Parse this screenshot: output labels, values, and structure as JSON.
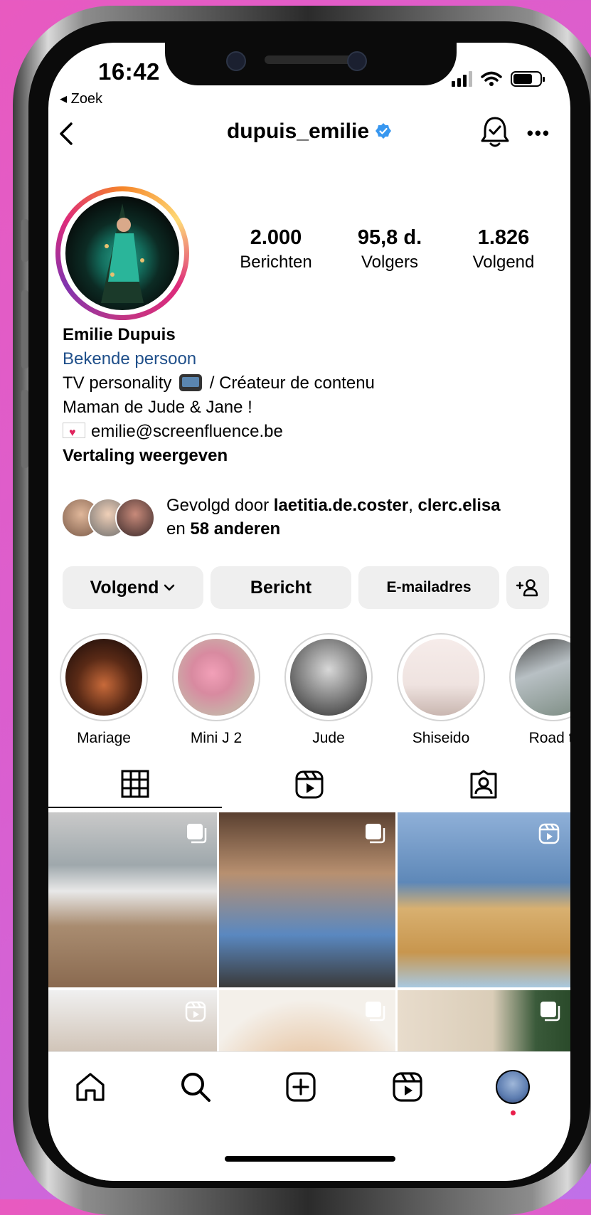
{
  "status_bar": {
    "time": "16:42",
    "back_app": "◂ Zoek"
  },
  "header": {
    "username": "dupuis_emilie"
  },
  "profile": {
    "stats": [
      {
        "value": "2.000",
        "label": "Berichten"
      },
      {
        "value": "95,8 d.",
        "label": "Volgers"
      },
      {
        "value": "1.826",
        "label": "Volgend"
      }
    ],
    "name": "Emilie Dupuis",
    "category": "Bekende persoon",
    "bio_line1_a": "TV personality",
    "bio_line1_b": " / Créateur de contenu",
    "bio_line2": "Maman de Jude & Jane !",
    "bio_email": "emilie@screenfluence.be",
    "translate": "Vertaling weergeven"
  },
  "followed_by": {
    "prefix": "Gevolgd door ",
    "user1": "laetitia.de.coster",
    "sep": ", ",
    "user2": "clerc.elisa",
    "and": "en ",
    "others": "58 anderen"
  },
  "actions": {
    "follow": "Volgend",
    "message": "Bericht",
    "email": "E-mailadres",
    "add_person": "+ႇ"
  },
  "highlights": [
    {
      "label": "Mariage"
    },
    {
      "label": "Mini J 2"
    },
    {
      "label": "Jude"
    },
    {
      "label": "Shiseido"
    },
    {
      "label": "Road tr"
    }
  ],
  "colors": {
    "accent_blue": "#3897f0",
    "category_link": "#1f4f8a",
    "notification_dot": "#e91e4a"
  },
  "icons": [
    "back-chevron-icon",
    "verified-badge-icon",
    "bell-icon",
    "more-icon",
    "grid-icon",
    "reels-icon",
    "tagged-icon",
    "carousel-icon",
    "home-icon",
    "search-icon",
    "create-icon",
    "reels-nav-icon"
  ]
}
